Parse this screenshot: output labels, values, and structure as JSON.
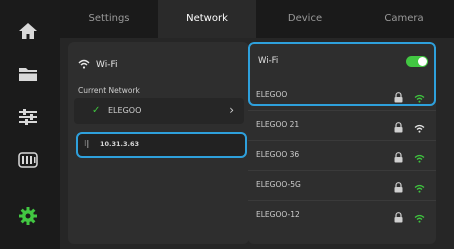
{
  "colors": {
    "accent_blue": "#2ea0dc",
    "active_green": "#42c742",
    "signal_green": "#3ec43e"
  },
  "rail": {
    "items": [
      {
        "icon": "home-icon",
        "active": false
      },
      {
        "icon": "folder-icon",
        "active": false
      },
      {
        "icon": "sliders-icon",
        "active": false
      },
      {
        "icon": "filament-icon",
        "active": false
      },
      {
        "icon": "gear-icon",
        "active": true
      }
    ]
  },
  "tabs": [
    {
      "label": "Settings",
      "active": false
    },
    {
      "label": "Network",
      "active": true
    },
    {
      "label": "Device",
      "active": false
    },
    {
      "label": "Camera",
      "active": false
    }
  ],
  "left_panel": {
    "wifi_label": "Wi-Fi",
    "current_network_label": "Current Network",
    "current_network_ssid": "ELEGOO",
    "ip_address": "10.31.3.63"
  },
  "right_panel": {
    "wifi_toggle_label": "Wi-Fi",
    "wifi_enabled": true,
    "networks": [
      {
        "ssid": "ELEGOO",
        "locked": true,
        "signal": "strong"
      },
      {
        "ssid": "ELEGOO 21",
        "locked": true,
        "signal": "medium"
      },
      {
        "ssid": "ELEGOO 36",
        "locked": true,
        "signal": "strong"
      },
      {
        "ssid": "ELEGOO-5G",
        "locked": true,
        "signal": "strong"
      },
      {
        "ssid": "ELEGOO-12",
        "locked": true,
        "signal": "strong"
      }
    ]
  }
}
